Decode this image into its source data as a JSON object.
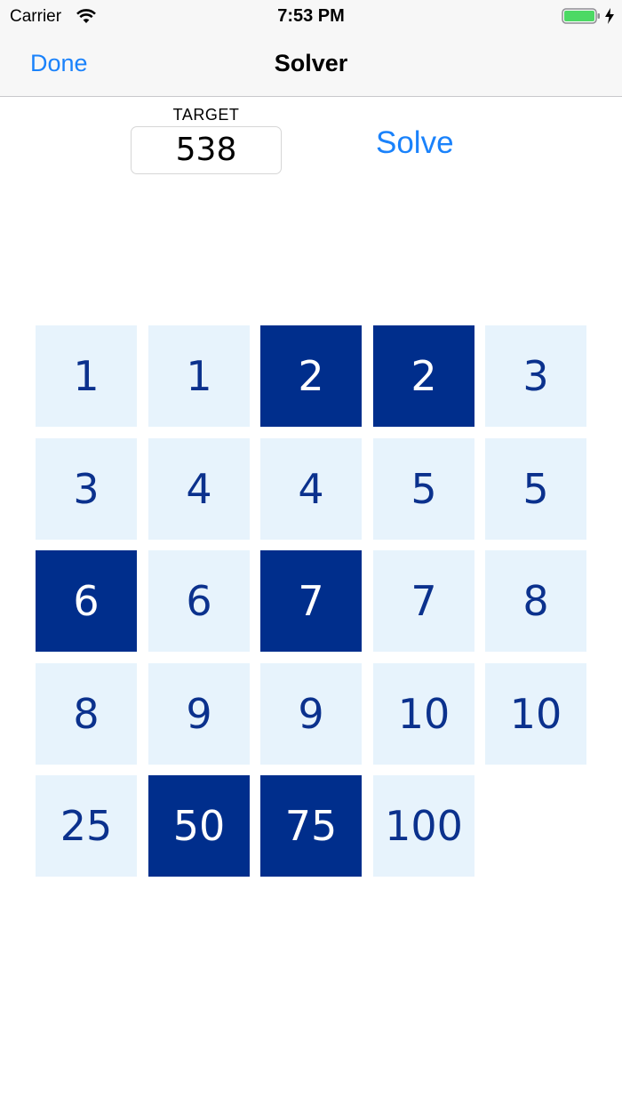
{
  "status": {
    "carrier": "Carrier",
    "time": "7:53 PM",
    "icons": [
      "wifi-icon",
      "battery-icon",
      "charging-bolt-icon"
    ]
  },
  "nav": {
    "done_label": "Done",
    "title": "Solver"
  },
  "target": {
    "label": "TARGET",
    "value": "538"
  },
  "solve_label": "Solve",
  "colors": {
    "accent": "#1a82fb",
    "tile_selected": "#002e8c",
    "tile_unselected": "#e7f3fc",
    "tile_text_unselected": "#0b318d"
  },
  "tiles": [
    {
      "value": "1",
      "selected": false
    },
    {
      "value": "1",
      "selected": false
    },
    {
      "value": "2",
      "selected": true
    },
    {
      "value": "2",
      "selected": true
    },
    {
      "value": "3",
      "selected": false
    },
    {
      "value": "3",
      "selected": false
    },
    {
      "value": "4",
      "selected": false
    },
    {
      "value": "4",
      "selected": false
    },
    {
      "value": "5",
      "selected": false
    },
    {
      "value": "5",
      "selected": false
    },
    {
      "value": "6",
      "selected": true
    },
    {
      "value": "6",
      "selected": false
    },
    {
      "value": "7",
      "selected": true
    },
    {
      "value": "7",
      "selected": false
    },
    {
      "value": "8",
      "selected": false
    },
    {
      "value": "8",
      "selected": false
    },
    {
      "value": "9",
      "selected": false
    },
    {
      "value": "9",
      "selected": false
    },
    {
      "value": "10",
      "selected": false
    },
    {
      "value": "10",
      "selected": false
    },
    {
      "value": "25",
      "selected": false
    },
    {
      "value": "50",
      "selected": true
    },
    {
      "value": "75",
      "selected": true
    },
    {
      "value": "100",
      "selected": false
    }
  ]
}
